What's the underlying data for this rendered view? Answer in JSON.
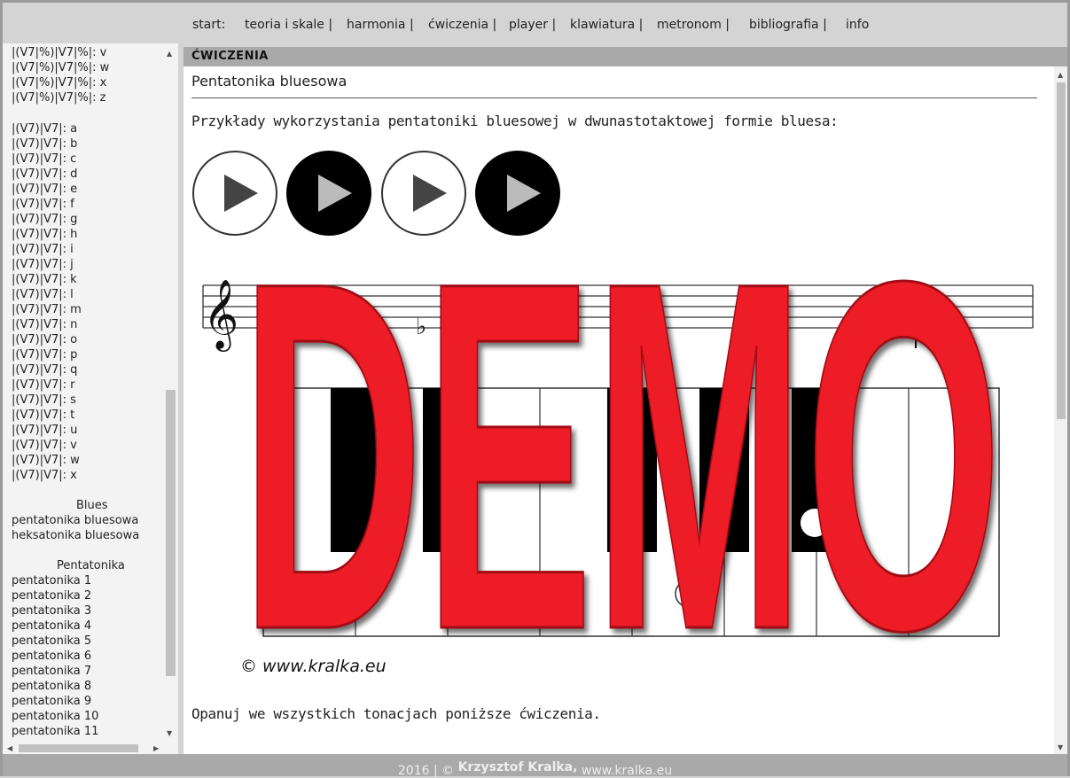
{
  "nav": {
    "start": "start:",
    "items": [
      "teoria i skale |",
      "harmonia |",
      "ćwiczenia |",
      "player |",
      "klawiatura |",
      "metronom |",
      "bibliografia |",
      "info"
    ]
  },
  "sidebar": {
    "group1": [
      "|(V7|%)|V7|%|: v",
      "|(V7|%)|V7|%|: w",
      "|(V7|%)|V7|%|: x",
      "|(V7|%)|V7|%|: z"
    ],
    "group2": [
      "|(V7)|V7|: a",
      "|(V7)|V7|: b",
      "|(V7)|V7|: c",
      "|(V7)|V7|: d",
      "|(V7)|V7|: e",
      "|(V7)|V7|: f",
      "|(V7)|V7|: g",
      "|(V7)|V7|: h",
      "|(V7)|V7|: i",
      "|(V7)|V7|: j",
      "|(V7)|V7|: k",
      "|(V7)|V7|: l",
      "|(V7)|V7|: m",
      "|(V7)|V7|: n",
      "|(V7)|V7|: o",
      "|(V7)|V7|: p",
      "|(V7)|V7|: q",
      "|(V7)|V7|: r",
      "|(V7)|V7|: s",
      "|(V7)|V7|: t",
      "|(V7)|V7|: u",
      "|(V7)|V7|: v",
      "|(V7)|V7|: w",
      "|(V7)|V7|: x"
    ],
    "blues_heading": "Blues",
    "blues": [
      "pentatonika bluesowa",
      "heksatonika bluesowa"
    ],
    "penta_heading": "Pentatonika",
    "penta": [
      "pentatonika 1",
      "pentatonika 2",
      "pentatonika 3",
      "pentatonika 4",
      "pentatonika 5",
      "pentatonika 6",
      "pentatonika 7",
      "pentatonika 8",
      "pentatonika 9",
      "pentatonika 10",
      "pentatonika 11"
    ]
  },
  "main": {
    "section": "ĆWICZENIA",
    "title": "Pentatonika bluesowa",
    "intro": "Przykłady wykorzystania pentatoniki bluesowej w dwunastotaktowej formie bluesa:",
    "copyright": "© www.kralka.eu",
    "watermark": "DEMO",
    "outro": "Opanuj we wszystkich tonacjach poniższe ćwiczenia."
  },
  "footer": {
    "year": "2016 | ©",
    "author": "Krzysztof Kralka,",
    "site": "www.kralka.eu"
  },
  "colors": {
    "watermark": "#ee1c25",
    "header_bar": "#a9a9a9",
    "nav_bg": "#d4d4d4"
  }
}
